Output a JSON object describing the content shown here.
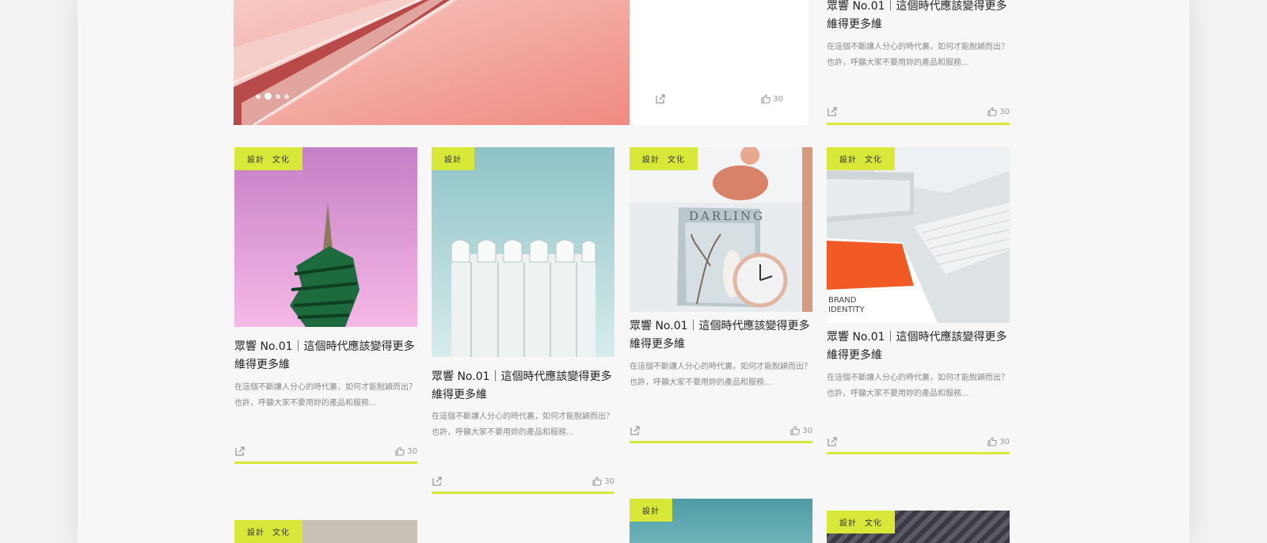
{
  "featured": {
    "dots": 4,
    "active_dot": 1,
    "middle_likes": "30"
  },
  "top_right_card": {
    "title": "眾響 No.01｜這個時代應該變得更多維得更多維",
    "desc": "在這個不斷讓人分心的時代裏，如何才能脫穎而出？也許，呼籲大家不要用妳的產品和服務...",
    "likes": "30"
  },
  "cards": [
    {
      "tags": [
        "設計",
        "文化"
      ],
      "title": "眾響 No.01｜這個時代應該變得更多維得更多維",
      "desc": "在這個不斷讓人分心的時代裏，如何才能脫穎而出？也許，呼籲大家不要用妳的產品和服務...",
      "likes": "30",
      "image": "pink-tower"
    },
    {
      "tags": [
        "設計"
      ],
      "title": "眾響 No.01｜這個時代應該變得更多維得更多維",
      "desc": "在這個不斷讓人分心的時代裏，如何才能脫穎而出？也許，呼籲大家不要用妳的產品和服務...",
      "likes": "30",
      "image": "white-building"
    },
    {
      "tags": [
        "設計",
        "文化"
      ],
      "title": "眾響 No.01｜這個時代應該變得更多維得更多維",
      "desc": "在這個不斷讓人分心的時代裏，如何才能脫穎而出？也許，呼籲大家不要用妳的產品和服務...",
      "likes": "30",
      "image": "clock-magazine",
      "magazine_text": "DARLING"
    },
    {
      "tags": [
        "設計",
        "文化"
      ],
      "title": "眾響 No.01｜這個時代應該變得更多維得更多維",
      "desc": "在這個不斷讓人分心的時代裏，如何才能脫穎而出？也許，呼籲大家不要用妳的產品和服務...",
      "likes": "30",
      "image": "desk-keyboard",
      "book_text_1": "BRAND",
      "book_text_2": "IDENTITY"
    }
  ],
  "bottom_cards": [
    {
      "tags": [
        "設計",
        "文化"
      ]
    },
    {
      "tags": [
        "設計"
      ]
    },
    {
      "tags": [
        "設計",
        "文化"
      ]
    }
  ],
  "colors": {
    "accent": "#d7e838",
    "page": "#f7f7f7"
  }
}
